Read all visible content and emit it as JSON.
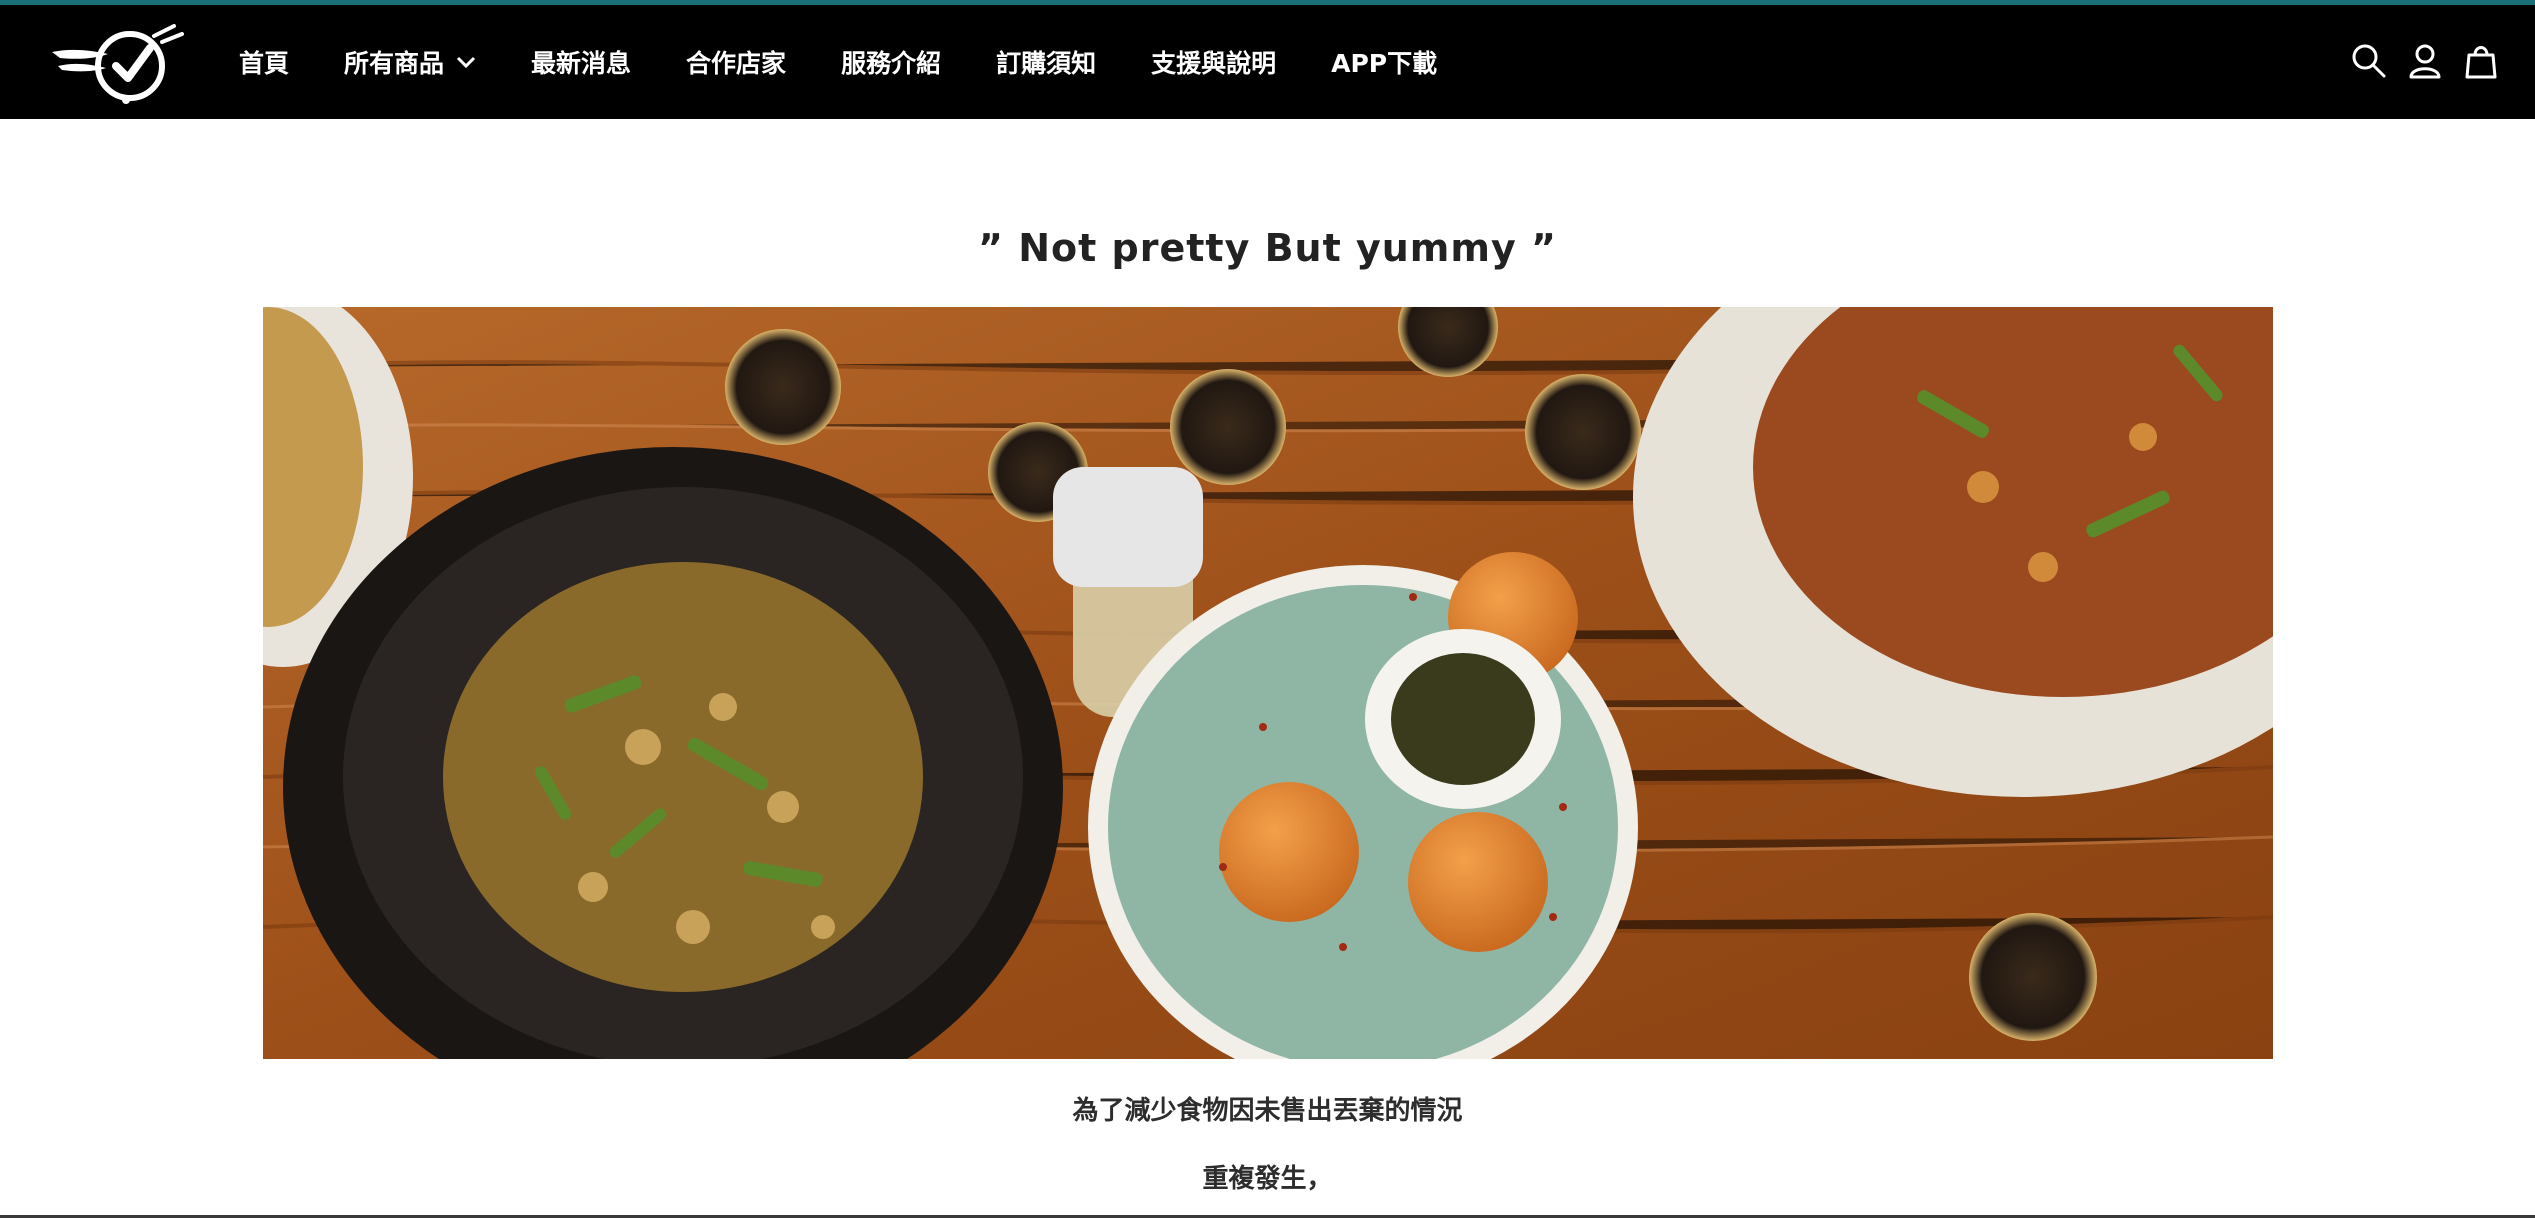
{
  "header": {
    "logo_icon": "clock-check-logo-icon",
    "nav": [
      {
        "label": "首頁"
      },
      {
        "label": "所有商品",
        "has_dropdown": true
      },
      {
        "label": "最新消息"
      },
      {
        "label": "合作店家"
      },
      {
        "label": "服務介紹"
      },
      {
        "label": "訂購須知"
      },
      {
        "label": "支援與說明"
      },
      {
        "label": "APP下載"
      }
    ],
    "icons": [
      "search-icon",
      "account-icon",
      "cart-icon"
    ],
    "accent_color": "#1b6f78"
  },
  "main": {
    "tagline": "” Not pretty But yummy ”",
    "hero_image": "food-plates-on-wooden-table-image",
    "paragraphs": [
      "為了減少食物因未售出丟棄的情況",
      "重複發生，"
    ]
  }
}
